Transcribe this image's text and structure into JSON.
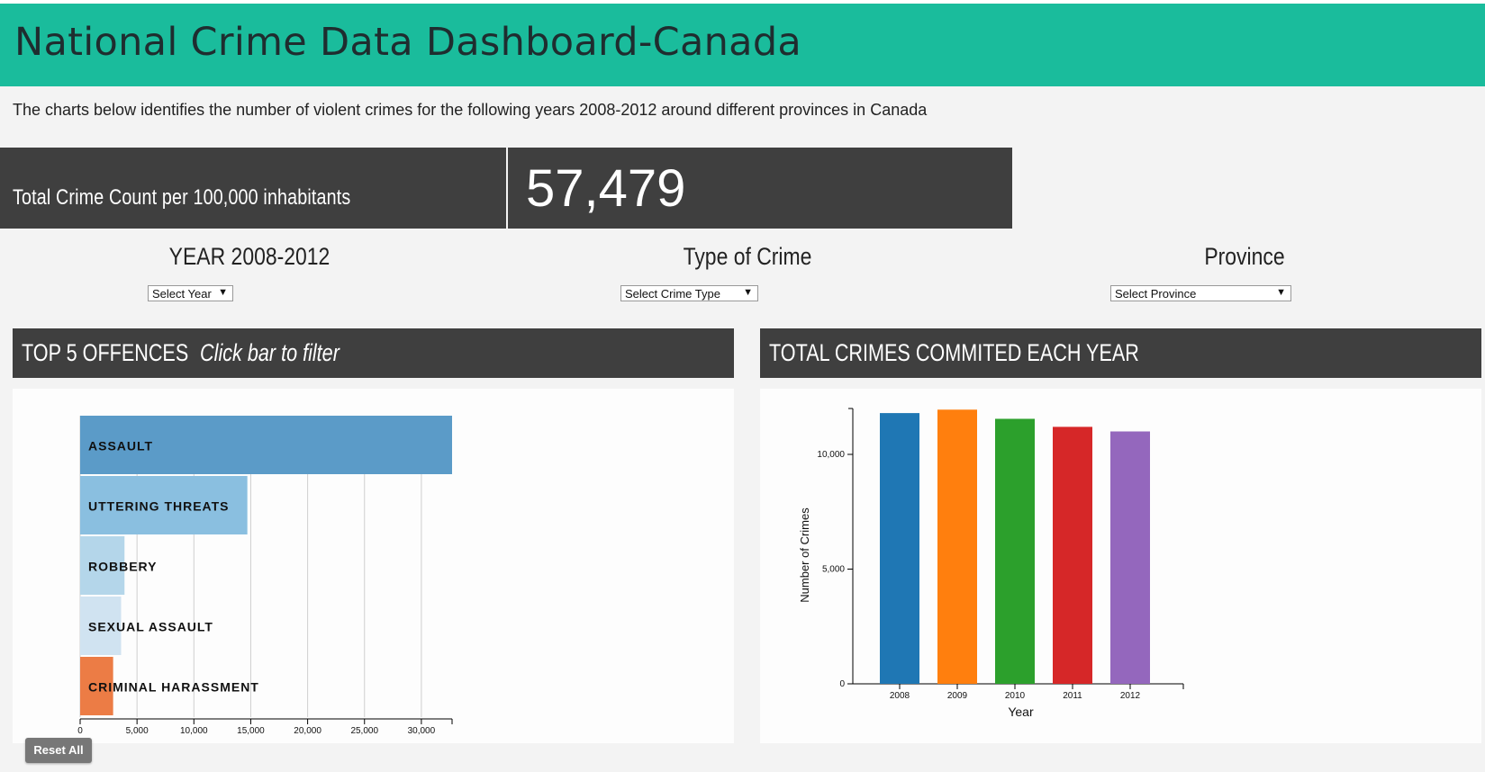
{
  "header": {
    "title": "National Crime Data Dashboard-Canada"
  },
  "intro": "The charts below identifies the number of violent crimes for the following years 2008-2012 around different provinces in Canada",
  "kpi": {
    "label": "Total Crime Count per 100,000 inhabitants",
    "value": "57,479"
  },
  "filters": {
    "year": {
      "title": "YEAR 2008-2012",
      "selected": "Select Year"
    },
    "crime": {
      "title": "Type of Crime",
      "selected": "Select Crime Type"
    },
    "province": {
      "title": "Province",
      "selected": "Select Province"
    }
  },
  "panels": {
    "left": {
      "title": "TOP 5 OFFENCES",
      "hint": "Click bar to filter"
    },
    "right": {
      "title": "TOTAL CRIMES COMMITED EACH YEAR"
    }
  },
  "reset_label": "Reset All",
  "chart_data": [
    {
      "type": "bar",
      "orientation": "horizontal",
      "categories": [
        "ASSAULT",
        "UTTERING THREATS",
        "ROBBERY",
        "SEXUAL ASSAULT",
        "CRIMINAL HARASSMENT"
      ],
      "values": [
        32700,
        14700,
        3900,
        3600,
        2900
      ],
      "colors": [
        "#5b9bc8",
        "#8abfe0",
        "#b4d6ea",
        "#d0e3f1",
        "#ec7c45"
      ],
      "xlim": [
        0,
        32700
      ],
      "xticks": [
        "0",
        "5,000",
        "10,000",
        "15,000",
        "20,000",
        "25,000",
        "30,000"
      ],
      "grid": true
    },
    {
      "type": "bar",
      "categories": [
        "2008",
        "2009",
        "2010",
        "2011",
        "2012"
      ],
      "values": [
        11800,
        11950,
        11550,
        11200,
        11000
      ],
      "colors": [
        "#1f77b4",
        "#ff7f0e",
        "#2ca02c",
        "#d62728",
        "#9467bd"
      ],
      "xlabel": "Year",
      "ylabel": "Number of Crimes",
      "ylim": [
        0,
        12000
      ],
      "yticks": [
        "0",
        "5,000",
        "10,000"
      ]
    }
  ]
}
